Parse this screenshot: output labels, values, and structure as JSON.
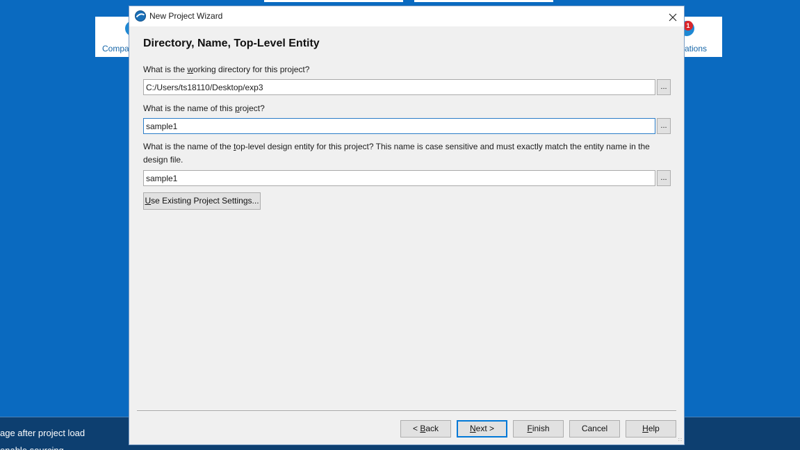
{
  "background": {
    "left_card_label": "Compa",
    "right_card_label": "ations",
    "notification_count": "1",
    "status_line_1": "age after project load",
    "status_line_2": "enable sourcing ..."
  },
  "dialog": {
    "title": "New Project Wizard",
    "heading": "Directory, Name, Top-Level Entity",
    "working_dir": {
      "question_before": "What is the ",
      "question_accel": "w",
      "question_after": "orking directory for this project?",
      "value": "C:/Users/ts18110/Desktop/exp3",
      "browse_label": "..."
    },
    "project_name": {
      "question_before": "What is the name of this ",
      "question_accel": "p",
      "question_after": "roject?",
      "value": "sample1",
      "browse_label": "..."
    },
    "top_level": {
      "question_before": "What is the name of the ",
      "question_accel": "t",
      "question_after": "op-level design entity for this project? This name is case sensitive and must exactly match the entity name in the design file.",
      "value": "sample1",
      "browse_label": "..."
    },
    "use_existing": {
      "accel": "U",
      "rest": "se Existing Project Settings..."
    },
    "buttons": {
      "back": {
        "prefix": "< ",
        "accel": "B",
        "rest": "ack"
      },
      "next": {
        "accel": "N",
        "rest": "ext >"
      },
      "finish": {
        "accel": "F",
        "rest": "inish"
      },
      "cancel": "Cancel",
      "help": {
        "accel": "H",
        "rest": "elp"
      }
    }
  },
  "colors": {
    "desktop": "#0a6ac0",
    "focus_border": "#2a7cc7",
    "default_button": "#0078d7"
  }
}
